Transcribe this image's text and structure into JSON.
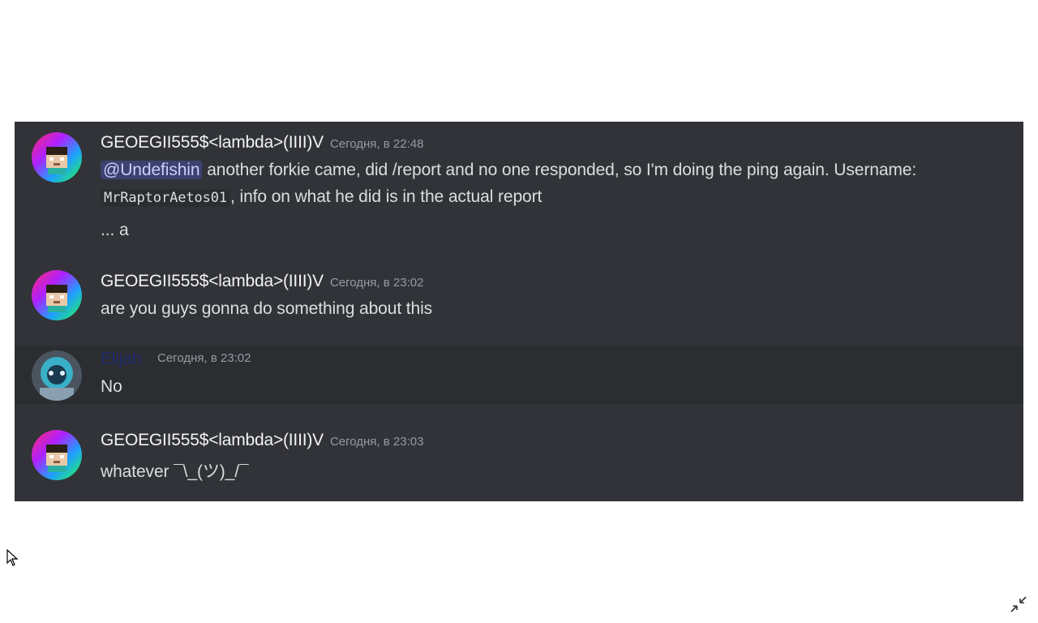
{
  "messages": [
    {
      "author": "GEOEGII555$<lambda>(IIII)V",
      "timestamp": "Сегодня, в 22:48",
      "mention": "@Undefishin",
      "text_after_mention": " another forkie came, did /report and no one responded, so I'm doing the ping again. Username:",
      "code": "MrRaptorAetos01",
      "text_after_code": ", info on what he did is in the actual report",
      "extra_line": "... a"
    },
    {
      "author": "GEOEGII555$<lambda>(IIII)V",
      "timestamp": "Сегодня, в 23:02",
      "text": "are you guys gonna do something about this"
    },
    {
      "author": "Elijah",
      "timestamp": "Сегодня, в 23:02",
      "text": "No"
    },
    {
      "author": "GEOEGII555$<lambda>(IIII)V",
      "timestamp": "Сегодня, в 23:03",
      "text": "whatever ¯\\_(ツ)_/¯"
    }
  ],
  "icons": {
    "cursor": "mouse-pointer-icon",
    "minimize": "exit-fullscreen-icon"
  },
  "colors": {
    "chat_background": "#313338",
    "highlight_background": "#2b2d31",
    "mention_background": "#3c4270",
    "elijah_name": "#1e2a6b"
  }
}
